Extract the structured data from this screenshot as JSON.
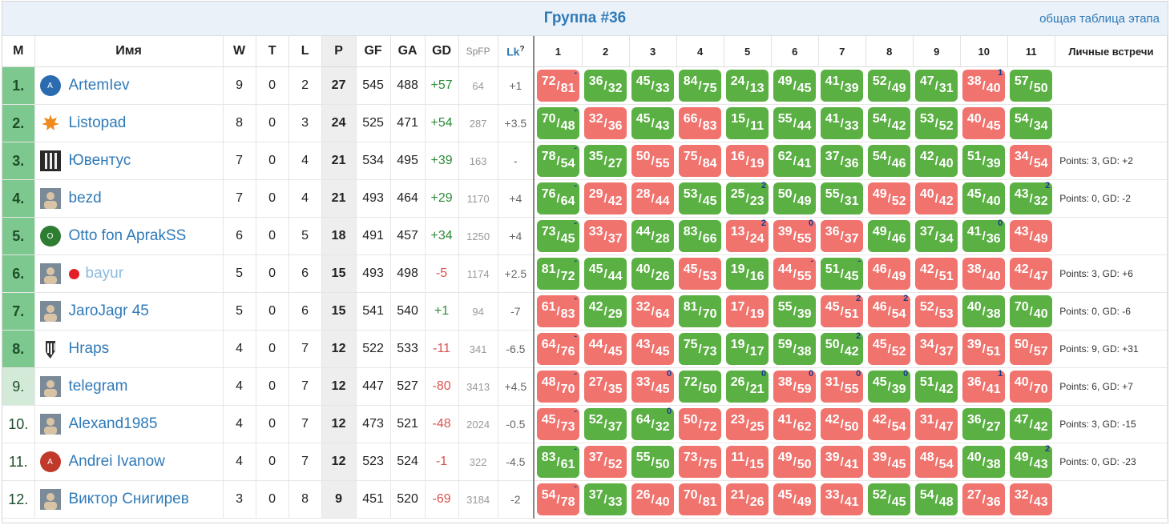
{
  "title": "Группа #36",
  "stage_link": "общая таблица этапа",
  "columns": {
    "m": "М",
    "name": "Имя",
    "w": "W",
    "t": "T",
    "l": "L",
    "p": "P",
    "gf": "GF",
    "ga": "GA",
    "gd": "GD",
    "spfp": "SpFP",
    "lk": "Lk",
    "lk_help": "?",
    "rounds": [
      "1",
      "2",
      "3",
      "4",
      "5",
      "6",
      "7",
      "8",
      "9",
      "10",
      "11"
    ],
    "h2h": "Личные встречи"
  },
  "colors": {
    "win": "#5ab043",
    "loss": "#f0736e",
    "link": "#2f7ab8",
    "promo": "#7cc88e",
    "playoff": "#d4ead8"
  },
  "rows": [
    {
      "m": "1.",
      "zone": "promo",
      "name": "ArtemIev",
      "faded": false,
      "reddot": false,
      "avatar": "avatar-letter-a-blue",
      "w": "9",
      "t": "0",
      "l": "2",
      "p": "27",
      "gf": "545",
      "ga": "488",
      "gd": "+57",
      "spfp": "64",
      "lk": "+1",
      "h2h": "",
      "games": [
        {
          "a": "72",
          "b": "81",
          "r": "l",
          "m": "-"
        },
        {
          "a": "36",
          "b": "32",
          "r": "w",
          "m": ""
        },
        {
          "a": "45",
          "b": "33",
          "r": "w",
          "m": ""
        },
        {
          "a": "84",
          "b": "75",
          "r": "w",
          "m": ""
        },
        {
          "a": "24",
          "b": "13",
          "r": "w",
          "m": ""
        },
        {
          "a": "49",
          "b": "45",
          "r": "w",
          "m": ""
        },
        {
          "a": "41",
          "b": "39",
          "r": "w",
          "m": ""
        },
        {
          "a": "52",
          "b": "49",
          "r": "w",
          "m": ""
        },
        {
          "a": "47",
          "b": "31",
          "r": "w",
          "m": ""
        },
        {
          "a": "38",
          "b": "40",
          "r": "l",
          "m": "1"
        },
        {
          "a": "57",
          "b": "50",
          "r": "w",
          "m": ""
        }
      ]
    },
    {
      "m": "2.",
      "zone": "promo",
      "name": "Listopad",
      "faded": false,
      "reddot": false,
      "avatar": "maple-leaf-icon",
      "w": "8",
      "t": "0",
      "l": "3",
      "p": "24",
      "gf": "525",
      "ga": "471",
      "gd": "+54",
      "spfp": "287",
      "lk": "+3.5",
      "h2h": "",
      "games": [
        {
          "a": "70",
          "b": "48",
          "r": "w",
          "m": "-"
        },
        {
          "a": "32",
          "b": "36",
          "r": "l",
          "m": ""
        },
        {
          "a": "45",
          "b": "43",
          "r": "w",
          "m": ""
        },
        {
          "a": "66",
          "b": "83",
          "r": "l",
          "m": ""
        },
        {
          "a": "15",
          "b": "11",
          "r": "w",
          "m": ""
        },
        {
          "a": "55",
          "b": "44",
          "r": "w",
          "m": ""
        },
        {
          "a": "41",
          "b": "33",
          "r": "w",
          "m": ""
        },
        {
          "a": "54",
          "b": "42",
          "r": "w",
          "m": ""
        },
        {
          "a": "53",
          "b": "52",
          "r": "w",
          "m": ""
        },
        {
          "a": "40",
          "b": "45",
          "r": "l",
          "m": ""
        },
        {
          "a": "54",
          "b": "34",
          "r": "w",
          "m": ""
        }
      ]
    },
    {
      "m": "3.",
      "zone": "promo",
      "name": "Ювентус",
      "faded": false,
      "reddot": false,
      "avatar": "juventus-photo",
      "w": "7",
      "t": "0",
      "l": "4",
      "p": "21",
      "gf": "534",
      "ga": "495",
      "gd": "+39",
      "spfp": "163",
      "lk": "-",
      "h2h": "Points: 3, GD: +2",
      "games": [
        {
          "a": "78",
          "b": "54",
          "r": "w",
          "m": "-"
        },
        {
          "a": "35",
          "b": "27",
          "r": "w",
          "m": ""
        },
        {
          "a": "50",
          "b": "55",
          "r": "l",
          "m": ""
        },
        {
          "a": "75",
          "b": "84",
          "r": "l",
          "m": ""
        },
        {
          "a": "16",
          "b": "19",
          "r": "l",
          "m": ""
        },
        {
          "a": "62",
          "b": "41",
          "r": "w",
          "m": ""
        },
        {
          "a": "37",
          "b": "36",
          "r": "w",
          "m": ""
        },
        {
          "a": "54",
          "b": "46",
          "r": "w",
          "m": ""
        },
        {
          "a": "42",
          "b": "40",
          "r": "w",
          "m": ""
        },
        {
          "a": "51",
          "b": "39",
          "r": "w",
          "m": ""
        },
        {
          "a": "34",
          "b": "54",
          "r": "l",
          "m": ""
        }
      ]
    },
    {
      "m": "4.",
      "zone": "promo",
      "name": "bezd",
      "faded": false,
      "reddot": false,
      "avatar": "user-photo",
      "w": "7",
      "t": "0",
      "l": "4",
      "p": "21",
      "gf": "493",
      "ga": "464",
      "gd": "+29",
      "spfp": "1170",
      "lk": "+4",
      "h2h": "Points: 0, GD: -2",
      "games": [
        {
          "a": "76",
          "b": "64",
          "r": "w",
          "m": "-"
        },
        {
          "a": "29",
          "b": "42",
          "r": "l",
          "m": ""
        },
        {
          "a": "28",
          "b": "44",
          "r": "l",
          "m": ""
        },
        {
          "a": "53",
          "b": "45",
          "r": "w",
          "m": ""
        },
        {
          "a": "25",
          "b": "23",
          "r": "w",
          "m": "2"
        },
        {
          "a": "50",
          "b": "49",
          "r": "w",
          "m": ""
        },
        {
          "a": "55",
          "b": "31",
          "r": "w",
          "m": ""
        },
        {
          "a": "49",
          "b": "52",
          "r": "l",
          "m": ""
        },
        {
          "a": "40",
          "b": "42",
          "r": "l",
          "m": ""
        },
        {
          "a": "45",
          "b": "40",
          "r": "w",
          "m": ""
        },
        {
          "a": "43",
          "b": "32",
          "r": "w",
          "m": "2"
        }
      ]
    },
    {
      "m": "5.",
      "zone": "promo",
      "name": "Otto fon AprakSS",
      "faded": false,
      "reddot": false,
      "avatar": "avatar-letter-o-green",
      "w": "6",
      "t": "0",
      "l": "5",
      "p": "18",
      "gf": "491",
      "ga": "457",
      "gd": "+34",
      "spfp": "1250",
      "lk": "+4",
      "h2h": "",
      "games": [
        {
          "a": "73",
          "b": "45",
          "r": "w",
          "m": "-"
        },
        {
          "a": "33",
          "b": "37",
          "r": "l",
          "m": ""
        },
        {
          "a": "44",
          "b": "28",
          "r": "w",
          "m": ""
        },
        {
          "a": "83",
          "b": "66",
          "r": "w",
          "m": ""
        },
        {
          "a": "13",
          "b": "24",
          "r": "l",
          "m": "2"
        },
        {
          "a": "39",
          "b": "55",
          "r": "l",
          "m": "0"
        },
        {
          "a": "36",
          "b": "37",
          "r": "l",
          "m": ""
        },
        {
          "a": "49",
          "b": "46",
          "r": "w",
          "m": ""
        },
        {
          "a": "37",
          "b": "34",
          "r": "w",
          "m": ""
        },
        {
          "a": "41",
          "b": "36",
          "r": "w",
          "m": "0"
        },
        {
          "a": "43",
          "b": "49",
          "r": "l",
          "m": ""
        }
      ]
    },
    {
      "m": "6.",
      "zone": "promo",
      "name": "bayur",
      "faded": true,
      "reddot": true,
      "avatar": "user-photo",
      "w": "5",
      "t": "0",
      "l": "6",
      "p": "15",
      "gf": "493",
      "ga": "498",
      "gd": "-5",
      "spfp": "1174",
      "lk": "+2.5",
      "h2h": "Points: 3, GD: +6",
      "games": [
        {
          "a": "81",
          "b": "72",
          "r": "w",
          "m": "-"
        },
        {
          "a": "45",
          "b": "44",
          "r": "w",
          "m": ""
        },
        {
          "a": "40",
          "b": "26",
          "r": "w",
          "m": ""
        },
        {
          "a": "45",
          "b": "53",
          "r": "l",
          "m": ""
        },
        {
          "a": "19",
          "b": "16",
          "r": "w",
          "m": ""
        },
        {
          "a": "44",
          "b": "55",
          "r": "l",
          "m": "-"
        },
        {
          "a": "51",
          "b": "45",
          "r": "w",
          "m": "-"
        },
        {
          "a": "46",
          "b": "49",
          "r": "l",
          "m": ""
        },
        {
          "a": "42",
          "b": "51",
          "r": "l",
          "m": ""
        },
        {
          "a": "38",
          "b": "40",
          "r": "l",
          "m": ""
        },
        {
          "a": "42",
          "b": "47",
          "r": "l",
          "m": ""
        }
      ]
    },
    {
      "m": "7.",
      "zone": "promo",
      "name": "JaroJagr 45",
      "faded": false,
      "reddot": false,
      "avatar": "user-photo",
      "w": "5",
      "t": "0",
      "l": "6",
      "p": "15",
      "gf": "541",
      "ga": "540",
      "gd": "+1",
      "spfp": "94",
      "lk": "-7",
      "h2h": "Points: 0, GD: -6",
      "games": [
        {
          "a": "61",
          "b": "83",
          "r": "l",
          "m": "-"
        },
        {
          "a": "42",
          "b": "29",
          "r": "w",
          "m": ""
        },
        {
          "a": "32",
          "b": "64",
          "r": "l",
          "m": ""
        },
        {
          "a": "81",
          "b": "70",
          "r": "w",
          "m": ""
        },
        {
          "a": "17",
          "b": "19",
          "r": "l",
          "m": ""
        },
        {
          "a": "55",
          "b": "39",
          "r": "w",
          "m": ""
        },
        {
          "a": "45",
          "b": "51",
          "r": "l",
          "m": "2"
        },
        {
          "a": "46",
          "b": "54",
          "r": "l",
          "m": "2"
        },
        {
          "a": "52",
          "b": "53",
          "r": "l",
          "m": ""
        },
        {
          "a": "40",
          "b": "38",
          "r": "w",
          "m": ""
        },
        {
          "a": "70",
          "b": "40",
          "r": "w",
          "m": ""
        }
      ]
    },
    {
      "m": "8.",
      "zone": "promo",
      "name": "Hraps",
      "faded": false,
      "reddot": false,
      "avatar": "juventus-logo",
      "w": "4",
      "t": "0",
      "l": "7",
      "p": "12",
      "gf": "522",
      "ga": "533",
      "gd": "-11",
      "spfp": "341",
      "lk": "-6.5",
      "h2h": "Points: 9, GD: +31",
      "games": [
        {
          "a": "64",
          "b": "76",
          "r": "l",
          "m": "-"
        },
        {
          "a": "44",
          "b": "45",
          "r": "l",
          "m": ""
        },
        {
          "a": "43",
          "b": "45",
          "r": "l",
          "m": ""
        },
        {
          "a": "75",
          "b": "73",
          "r": "w",
          "m": ""
        },
        {
          "a": "19",
          "b": "17",
          "r": "w",
          "m": ""
        },
        {
          "a": "59",
          "b": "38",
          "r": "w",
          "m": ""
        },
        {
          "a": "50",
          "b": "42",
          "r": "w",
          "m": "2"
        },
        {
          "a": "45",
          "b": "52",
          "r": "l",
          "m": ""
        },
        {
          "a": "34",
          "b": "37",
          "r": "l",
          "m": ""
        },
        {
          "a": "39",
          "b": "51",
          "r": "l",
          "m": ""
        },
        {
          "a": "50",
          "b": "57",
          "r": "l",
          "m": ""
        }
      ]
    },
    {
      "m": "9.",
      "zone": "playoff",
      "name": "telegram",
      "faded": false,
      "reddot": false,
      "avatar": "user-photo",
      "w": "4",
      "t": "0",
      "l": "7",
      "p": "12",
      "gf": "447",
      "ga": "527",
      "gd": "-80",
      "spfp": "3413",
      "lk": "+4.5",
      "h2h": "Points: 6, GD: +7",
      "games": [
        {
          "a": "48",
          "b": "70",
          "r": "l",
          "m": "-"
        },
        {
          "a": "27",
          "b": "35",
          "r": "l",
          "m": ""
        },
        {
          "a": "33",
          "b": "45",
          "r": "l",
          "m": "0"
        },
        {
          "a": "72",
          "b": "50",
          "r": "w",
          "m": ""
        },
        {
          "a": "26",
          "b": "21",
          "r": "w",
          "m": "0"
        },
        {
          "a": "38",
          "b": "59",
          "r": "l",
          "m": "0"
        },
        {
          "a": "31",
          "b": "55",
          "r": "l",
          "m": "0"
        },
        {
          "a": "45",
          "b": "39",
          "r": "w",
          "m": "0"
        },
        {
          "a": "51",
          "b": "42",
          "r": "w",
          "m": ""
        },
        {
          "a": "36",
          "b": "41",
          "r": "l",
          "m": "1"
        },
        {
          "a": "40",
          "b": "70",
          "r": "l",
          "m": ""
        }
      ]
    },
    {
      "m": "10.",
      "zone": "normal",
      "name": "Alexand1985",
      "faded": false,
      "reddot": false,
      "avatar": "user-photo",
      "w": "4",
      "t": "0",
      "l": "7",
      "p": "12",
      "gf": "473",
      "ga": "521",
      "gd": "-48",
      "spfp": "2024",
      "lk": "-0.5",
      "h2h": "Points: 3, GD: -15",
      "games": [
        {
          "a": "45",
          "b": "73",
          "r": "l",
          "m": "-"
        },
        {
          "a": "52",
          "b": "37",
          "r": "w",
          "m": ""
        },
        {
          "a": "64",
          "b": "32",
          "r": "w",
          "m": "0"
        },
        {
          "a": "50",
          "b": "72",
          "r": "l",
          "m": ""
        },
        {
          "a": "23",
          "b": "25",
          "r": "l",
          "m": ""
        },
        {
          "a": "41",
          "b": "62",
          "r": "l",
          "m": ""
        },
        {
          "a": "42",
          "b": "50",
          "r": "l",
          "m": ""
        },
        {
          "a": "42",
          "b": "54",
          "r": "l",
          "m": ""
        },
        {
          "a": "31",
          "b": "47",
          "r": "l",
          "m": ""
        },
        {
          "a": "36",
          "b": "27",
          "r": "w",
          "m": ""
        },
        {
          "a": "47",
          "b": "42",
          "r": "w",
          "m": ""
        }
      ]
    },
    {
      "m": "11.",
      "zone": "normal",
      "name": "Andrei Ivanow",
      "faded": false,
      "reddot": false,
      "avatar": "avatar-letter-a-red",
      "w": "4",
      "t": "0",
      "l": "7",
      "p": "12",
      "gf": "523",
      "ga": "524",
      "gd": "-1",
      "spfp": "322",
      "lk": "-4.5",
      "h2h": "Points: 0, GD: -23",
      "games": [
        {
          "a": "83",
          "b": "61",
          "r": "w",
          "m": "-"
        },
        {
          "a": "37",
          "b": "52",
          "r": "l",
          "m": ""
        },
        {
          "a": "55",
          "b": "50",
          "r": "w",
          "m": ""
        },
        {
          "a": "73",
          "b": "75",
          "r": "l",
          "m": ""
        },
        {
          "a": "11",
          "b": "15",
          "r": "l",
          "m": ""
        },
        {
          "a": "49",
          "b": "50",
          "r": "l",
          "m": ""
        },
        {
          "a": "39",
          "b": "41",
          "r": "l",
          "m": ""
        },
        {
          "a": "39",
          "b": "45",
          "r": "l",
          "m": ""
        },
        {
          "a": "48",
          "b": "54",
          "r": "l",
          "m": ""
        },
        {
          "a": "40",
          "b": "38",
          "r": "w",
          "m": ""
        },
        {
          "a": "49",
          "b": "43",
          "r": "w",
          "m": "2"
        }
      ]
    },
    {
      "m": "12.",
      "zone": "normal",
      "name": "Виктор Снигирев",
      "faded": false,
      "reddot": false,
      "avatar": "user-photo",
      "w": "3",
      "t": "0",
      "l": "8",
      "p": "9",
      "gf": "451",
      "ga": "520",
      "gd": "-69",
      "spfp": "3184",
      "lk": "-2",
      "h2h": "",
      "games": [
        {
          "a": "54",
          "b": "78",
          "r": "l",
          "m": "-"
        },
        {
          "a": "37",
          "b": "33",
          "r": "w",
          "m": ""
        },
        {
          "a": "26",
          "b": "40",
          "r": "l",
          "m": ""
        },
        {
          "a": "70",
          "b": "81",
          "r": "l",
          "m": ""
        },
        {
          "a": "21",
          "b": "26",
          "r": "l",
          "m": ""
        },
        {
          "a": "45",
          "b": "49",
          "r": "l",
          "m": ""
        },
        {
          "a": "33",
          "b": "41",
          "r": "l",
          "m": ""
        },
        {
          "a": "52",
          "b": "45",
          "r": "w",
          "m": ""
        },
        {
          "a": "54",
          "b": "48",
          "r": "w",
          "m": ""
        },
        {
          "a": "27",
          "b": "36",
          "r": "l",
          "m": ""
        },
        {
          "a": "32",
          "b": "43",
          "r": "l",
          "m": ""
        }
      ]
    }
  ]
}
